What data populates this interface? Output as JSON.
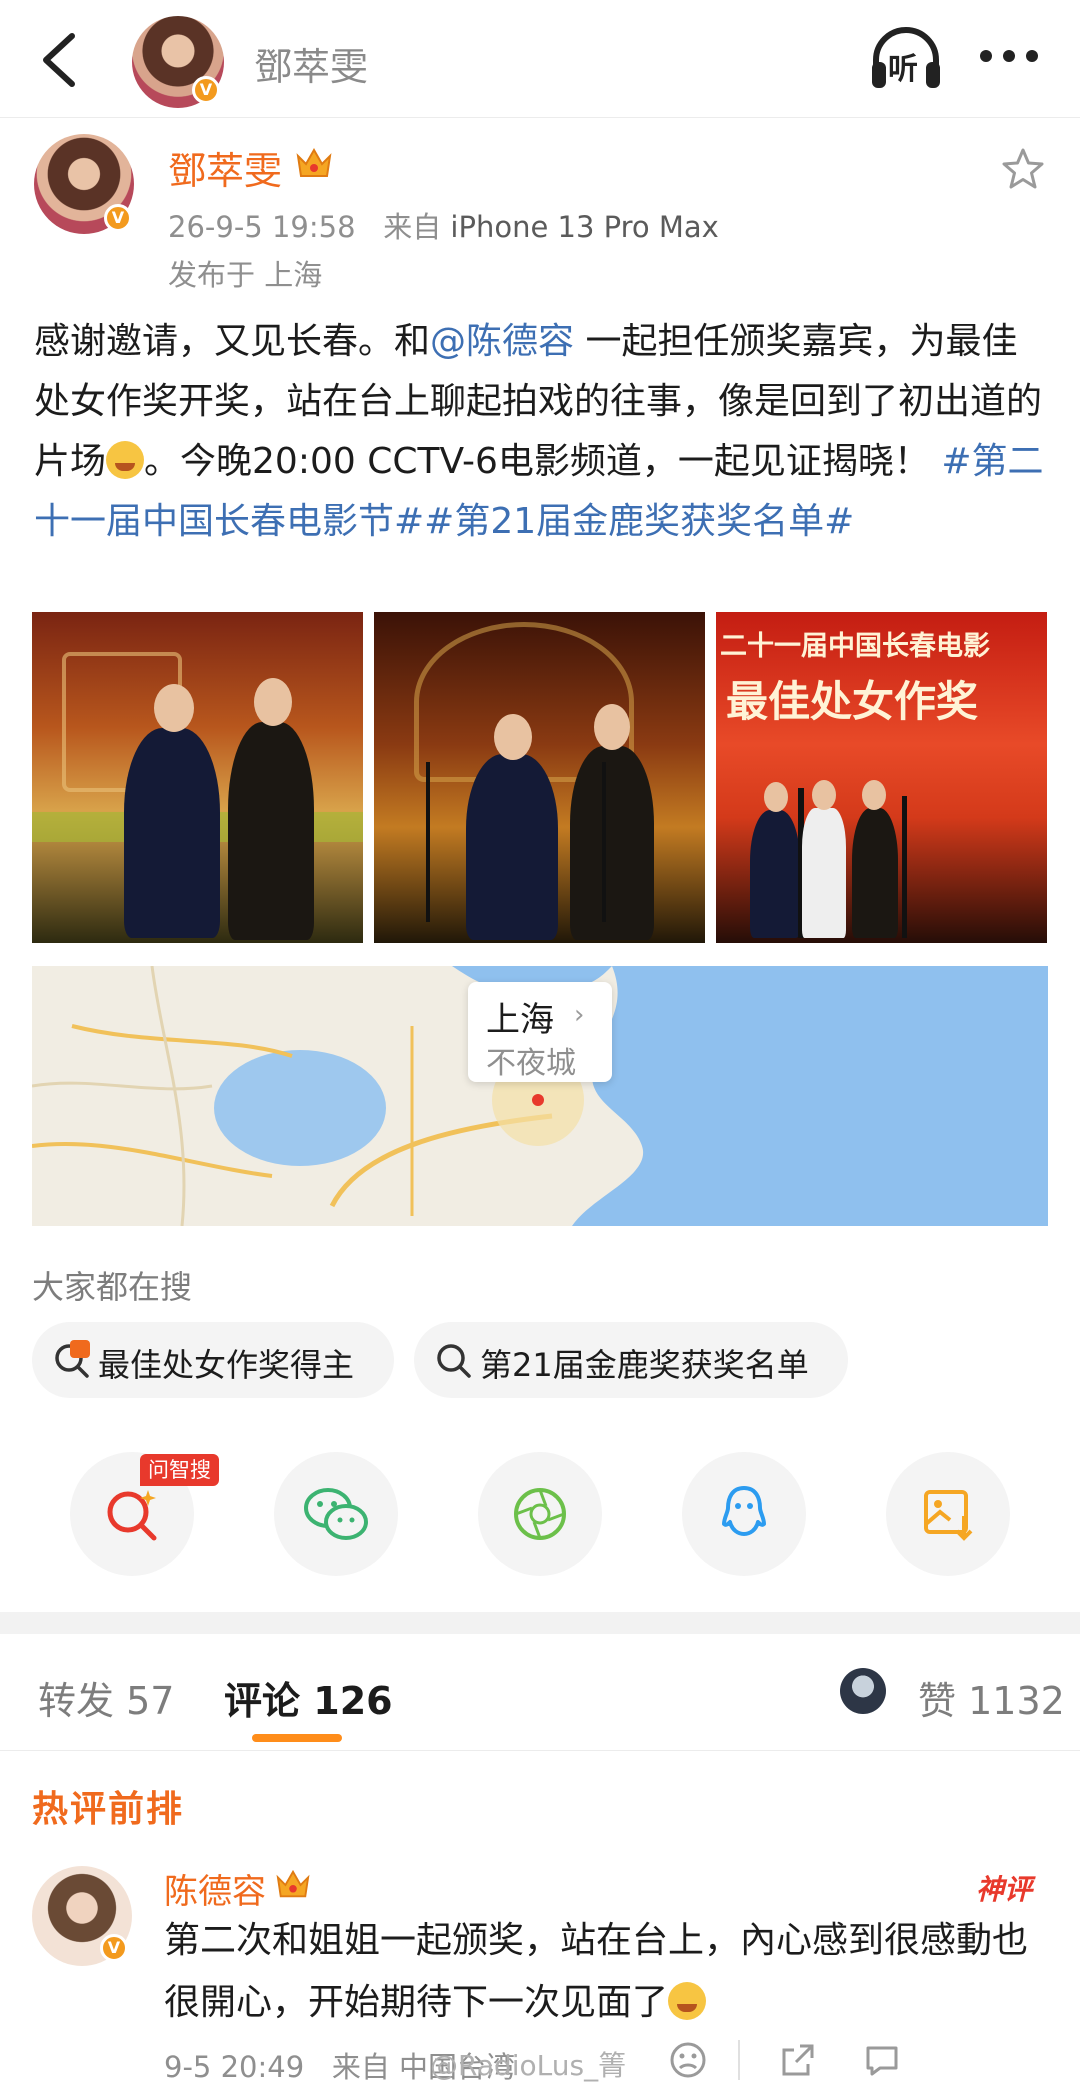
{
  "header": {
    "title": "鄧萃雯",
    "listen_label": "听"
  },
  "post": {
    "author": "鄧萃雯",
    "time": "26-9-5 19:58",
    "source_prefix": "来自",
    "device": "iPhone 13 Pro Max",
    "location_line": "发布于 上海",
    "text": {
      "p1": "感谢邀请，又见长春。和",
      "mention": "@陈德容",
      "p2": " 一起担任颁奖嘉宾，为最佳处女作奖开奖，站在台上聊起拍戏的往事，像是回到了初出道的片场",
      "p3": "。今晚20:00 CCTV-6电影频道，一起见证揭晓！ ",
      "topic1": "#第二十一届中国长春电影节#",
      "topic2": "#第21届金鹿奖获奖名单#"
    },
    "photo3_banner_line1": "二十一届中国长春电影",
    "photo3_banner_line2": "最佳处女作奖",
    "map": {
      "city": "上海",
      "subtitle": "不夜城"
    }
  },
  "search_section": {
    "title": "大家都在搜",
    "chips": [
      {
        "label": "最佳处女作奖得主",
        "icon": "hot-search-icon"
      },
      {
        "label": "第21届金鹿奖获奖名单",
        "icon": "search-icon"
      }
    ]
  },
  "share": {
    "ai_badge": "问智搜",
    "buttons": [
      "ai-search-icon",
      "wechat-icon",
      "moments-icon",
      "qq-icon",
      "save-image-icon"
    ]
  },
  "tabs": {
    "repost_label": "转发",
    "repost_count": "57",
    "comment_label": "评论",
    "comment_count": "126",
    "like_label": "赞",
    "like_count": "1132"
  },
  "comments": {
    "section_title": "热评前排",
    "items": [
      {
        "user": "陈德容",
        "badge": "神评",
        "text": "第二次和姐姐一起颁奖，站在台上，內心感到很感動也很開心，开始期待下一次见面了",
        "time": "9-5 20:49",
        "source": "来自 中国台湾"
      }
    ]
  },
  "watermark": "@RadioLus_箐"
}
